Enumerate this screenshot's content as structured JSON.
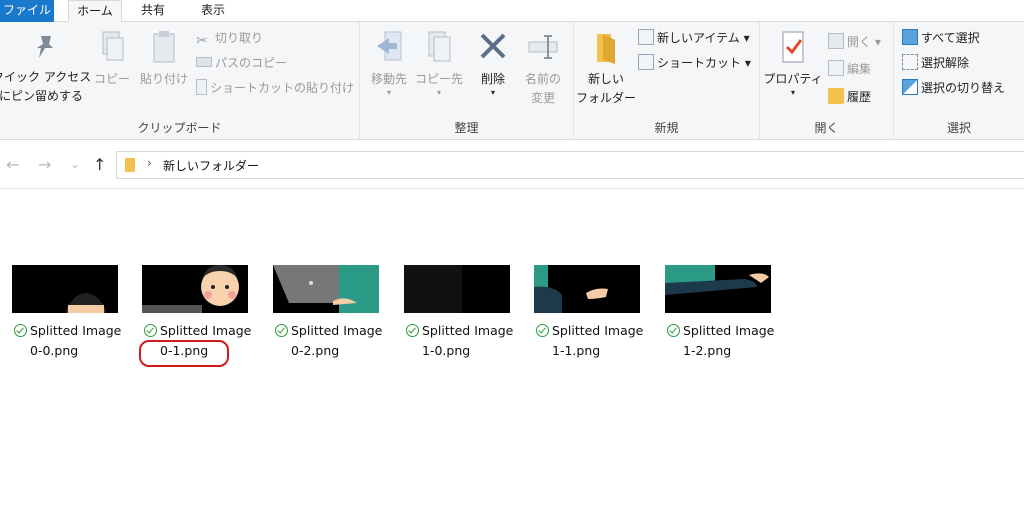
{
  "tabs": {
    "file": "ファイル",
    "home": "ホーム",
    "share": "共有",
    "view": "表示"
  },
  "ribbon": {
    "clipboard": {
      "label": "クリップボード",
      "pin_line1": "クイック アクセス",
      "pin_line2": "にピン留めする",
      "copy": "コピー",
      "paste": "貼り付け",
      "cut": "切り取り",
      "copy_path": "パスのコピー",
      "paste_shortcut": "ショートカットの貼り付け"
    },
    "organize": {
      "label": "整理",
      "move": "移動先",
      "copy_to": "コピー先",
      "delete": "削除",
      "rename_line1": "名前の",
      "rename_line2": "変更"
    },
    "new": {
      "label": "新規",
      "new_folder_line1": "新しい",
      "new_folder_line2": "フォルダー",
      "new_item": "新しいアイテム ▾",
      "easy_access": "ショートカット ▾"
    },
    "open": {
      "label": "開く",
      "properties": "プロパティ",
      "open": "開く ▾",
      "edit": "編集",
      "history": "履歴"
    },
    "select": {
      "label": "選択",
      "select_all": "すべて選択",
      "select_none": "選択解除",
      "invert": "選択の切り替え"
    }
  },
  "address": {
    "back": "←",
    "forward": "→",
    "recent": "⌄",
    "up": "↑",
    "path": "新しいフォルダー"
  },
  "files": [
    {
      "line1": "Splitted Image",
      "line2": "0-0.png"
    },
    {
      "line1": "Splitted Image",
      "line2": "0-1.png"
    },
    {
      "line1": "Splitted Image",
      "line2": "0-2.png"
    },
    {
      "line1": "Splitted Image",
      "line2": "1-0.png"
    },
    {
      "line1": "Splitted Image",
      "line2": "1-1.png"
    },
    {
      "line1": "Splitted Image",
      "line2": "1-2.png"
    }
  ],
  "colors": {
    "accent": "#1979ca",
    "highlight_ring": "#d01b1b",
    "sync_check": "#2b9a3b"
  }
}
